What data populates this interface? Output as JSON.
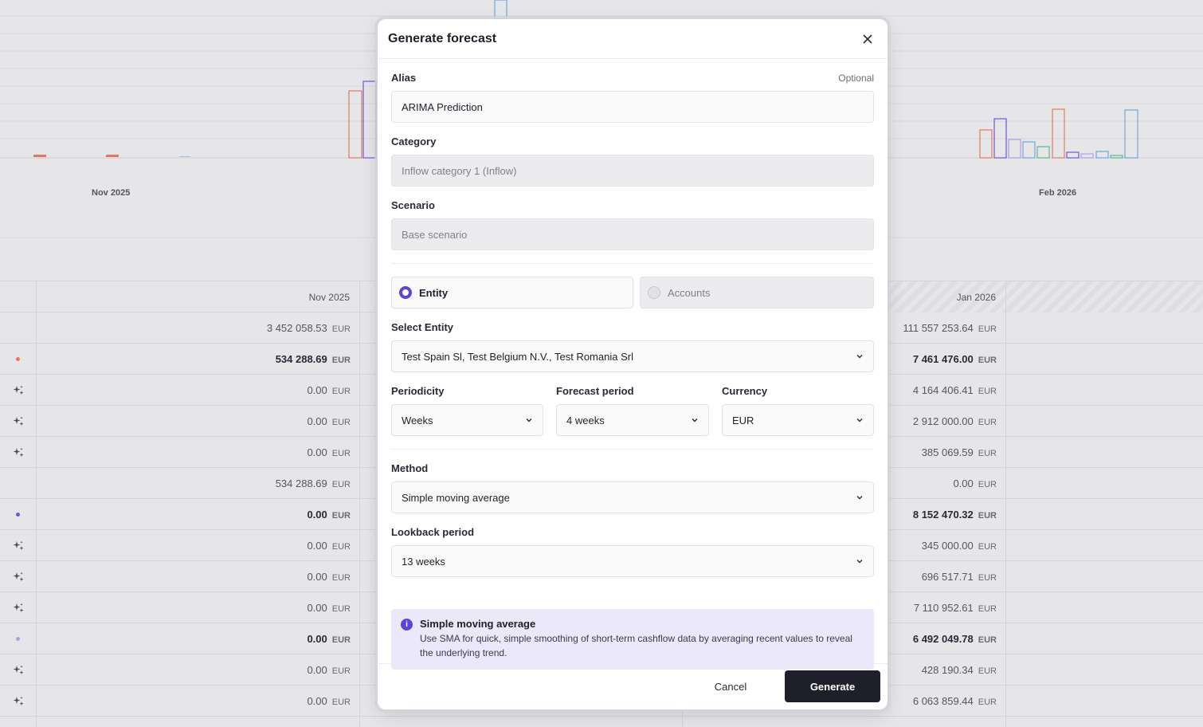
{
  "background": {
    "months": [
      {
        "label": "Nov 2025"
      },
      {
        "label": "Feb 2026"
      }
    ],
    "table": {
      "headers": [
        "Nov 2025",
        "Jan 2026"
      ],
      "currency": "EUR",
      "rows": [
        {
          "marker": "none",
          "nov": "3 452 058.53",
          "jan": "111 557 253.64",
          "bold": false
        },
        {
          "marker": "dot-orange",
          "nov": "534 288.69",
          "jan": "7 461 476.00",
          "bold": true
        },
        {
          "marker": "sparkle",
          "nov": "0.00",
          "jan": "4 164 406.41",
          "bold": false
        },
        {
          "marker": "sparkle",
          "nov": "0.00",
          "jan": "2 912 000.00",
          "bold": false
        },
        {
          "marker": "sparkle",
          "nov": "0.00",
          "jan": "385 069.59",
          "bold": false
        },
        {
          "marker": "none",
          "nov": "534 288.69",
          "jan": "0.00",
          "bold": false
        },
        {
          "marker": "dot-purple",
          "nov": "0.00",
          "jan": "8 152 470.32",
          "bold": true
        },
        {
          "marker": "sparkle",
          "nov": "0.00",
          "jan": "345 000.00",
          "bold": false
        },
        {
          "marker": "sparkle",
          "nov": "0.00",
          "jan": "696 517.71",
          "bold": false
        },
        {
          "marker": "sparkle",
          "nov": "0.00",
          "jan": "7 110 952.61",
          "bold": false
        },
        {
          "marker": "dot-lilac",
          "nov": "0.00",
          "jan": "6 492 049.78",
          "bold": true
        },
        {
          "marker": "sparkle",
          "nov": "0.00",
          "jan": "428 190.34",
          "bold": false
        },
        {
          "marker": "sparkle",
          "nov": "0.00",
          "jan": "6 063 859.44",
          "bold": false
        }
      ]
    }
  },
  "modal": {
    "title": "Generate forecast",
    "alias": {
      "label": "Alias",
      "optional": "Optional",
      "value": "ARIMA Prediction"
    },
    "category": {
      "label": "Category",
      "value": "Inflow category 1 (Inflow)"
    },
    "scenario": {
      "label": "Scenario",
      "value": "Base scenario"
    },
    "scope": {
      "entity": "Entity",
      "accounts": "Accounts",
      "selected": "Entity"
    },
    "select_entity": {
      "label": "Select Entity",
      "value": "Test Spain Sl, Test Belgium N.V., Test Romania Srl"
    },
    "periodicity": {
      "label": "Periodicity",
      "value": "Weeks"
    },
    "forecast_period": {
      "label": "Forecast period",
      "value": "4 weeks"
    },
    "currency": {
      "label": "Currency",
      "value": "EUR"
    },
    "method": {
      "label": "Method",
      "value": "Simple moving average"
    },
    "lookback": {
      "label": "Lookback period",
      "value": "13 weeks"
    },
    "info": {
      "title": "Simple moving average",
      "text": "Use SMA for quick, simple smoothing of short-term cashflow data by averaging recent values to reveal the underlying trend."
    },
    "cancel_label": "Cancel",
    "generate_label": "Generate"
  },
  "colors": {
    "accent": "#5a45d8",
    "button_dark": "#1f1f2b",
    "info_bg": "#ebe8fa",
    "dot_orange": "#e07a5f",
    "dot_purple": "#6b57d9",
    "dot_lilac": "#b49be8"
  }
}
